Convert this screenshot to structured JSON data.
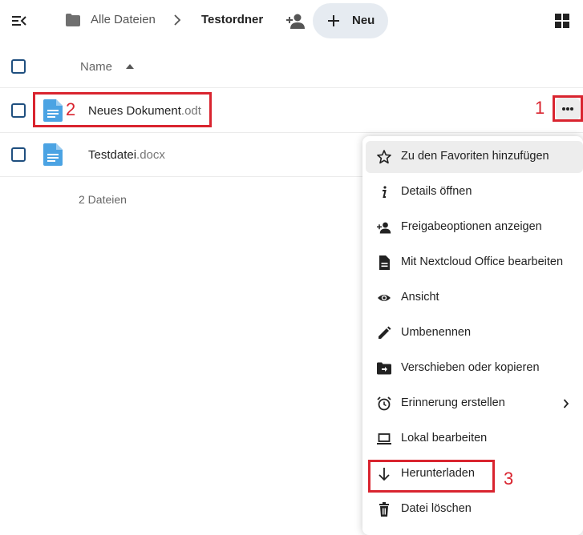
{
  "breadcrumb": {
    "root": "Alle Dateien",
    "current": "Testordner"
  },
  "toolbar": {
    "new_label": "Neu"
  },
  "list": {
    "column_name": "Name",
    "files": [
      {
        "base": "Neues Dokument",
        "ext": ".odt",
        "icon": "document-icon"
      },
      {
        "base": "Testdatei",
        "ext": ".docx",
        "icon": "document-icon"
      }
    ],
    "summary": "2 Dateien"
  },
  "context_menu": {
    "items": [
      {
        "label": "Zu den Favoriten hinzufügen",
        "icon": "star-icon"
      },
      {
        "label": "Details öffnen",
        "icon": "info-icon"
      },
      {
        "label": "Freigabeoptionen anzeigen",
        "icon": "share-icon"
      },
      {
        "label": "Mit Nextcloud Office bearbeiten",
        "icon": "document-icon"
      },
      {
        "label": "Ansicht",
        "icon": "eye-icon"
      },
      {
        "label": "Umbenennen",
        "icon": "pencil-icon"
      },
      {
        "label": "Verschieben oder kopieren",
        "icon": "folder-move-icon"
      },
      {
        "label": "Erinnerung erstellen",
        "icon": "alarm-icon"
      },
      {
        "label": "Lokal bearbeiten",
        "icon": "laptop-icon"
      },
      {
        "label": "Herunterladen",
        "icon": "download-icon"
      },
      {
        "label": "Datei löschen",
        "icon": "trash-icon"
      }
    ]
  },
  "annotations": {
    "step1": "1",
    "step2": "2",
    "step3": "3"
  },
  "colors": {
    "accent": "#1f4f7f",
    "file_icon": "#4ba3e3",
    "highlight": "#d9242f",
    "new_button_bg": "#e6ebf1"
  }
}
